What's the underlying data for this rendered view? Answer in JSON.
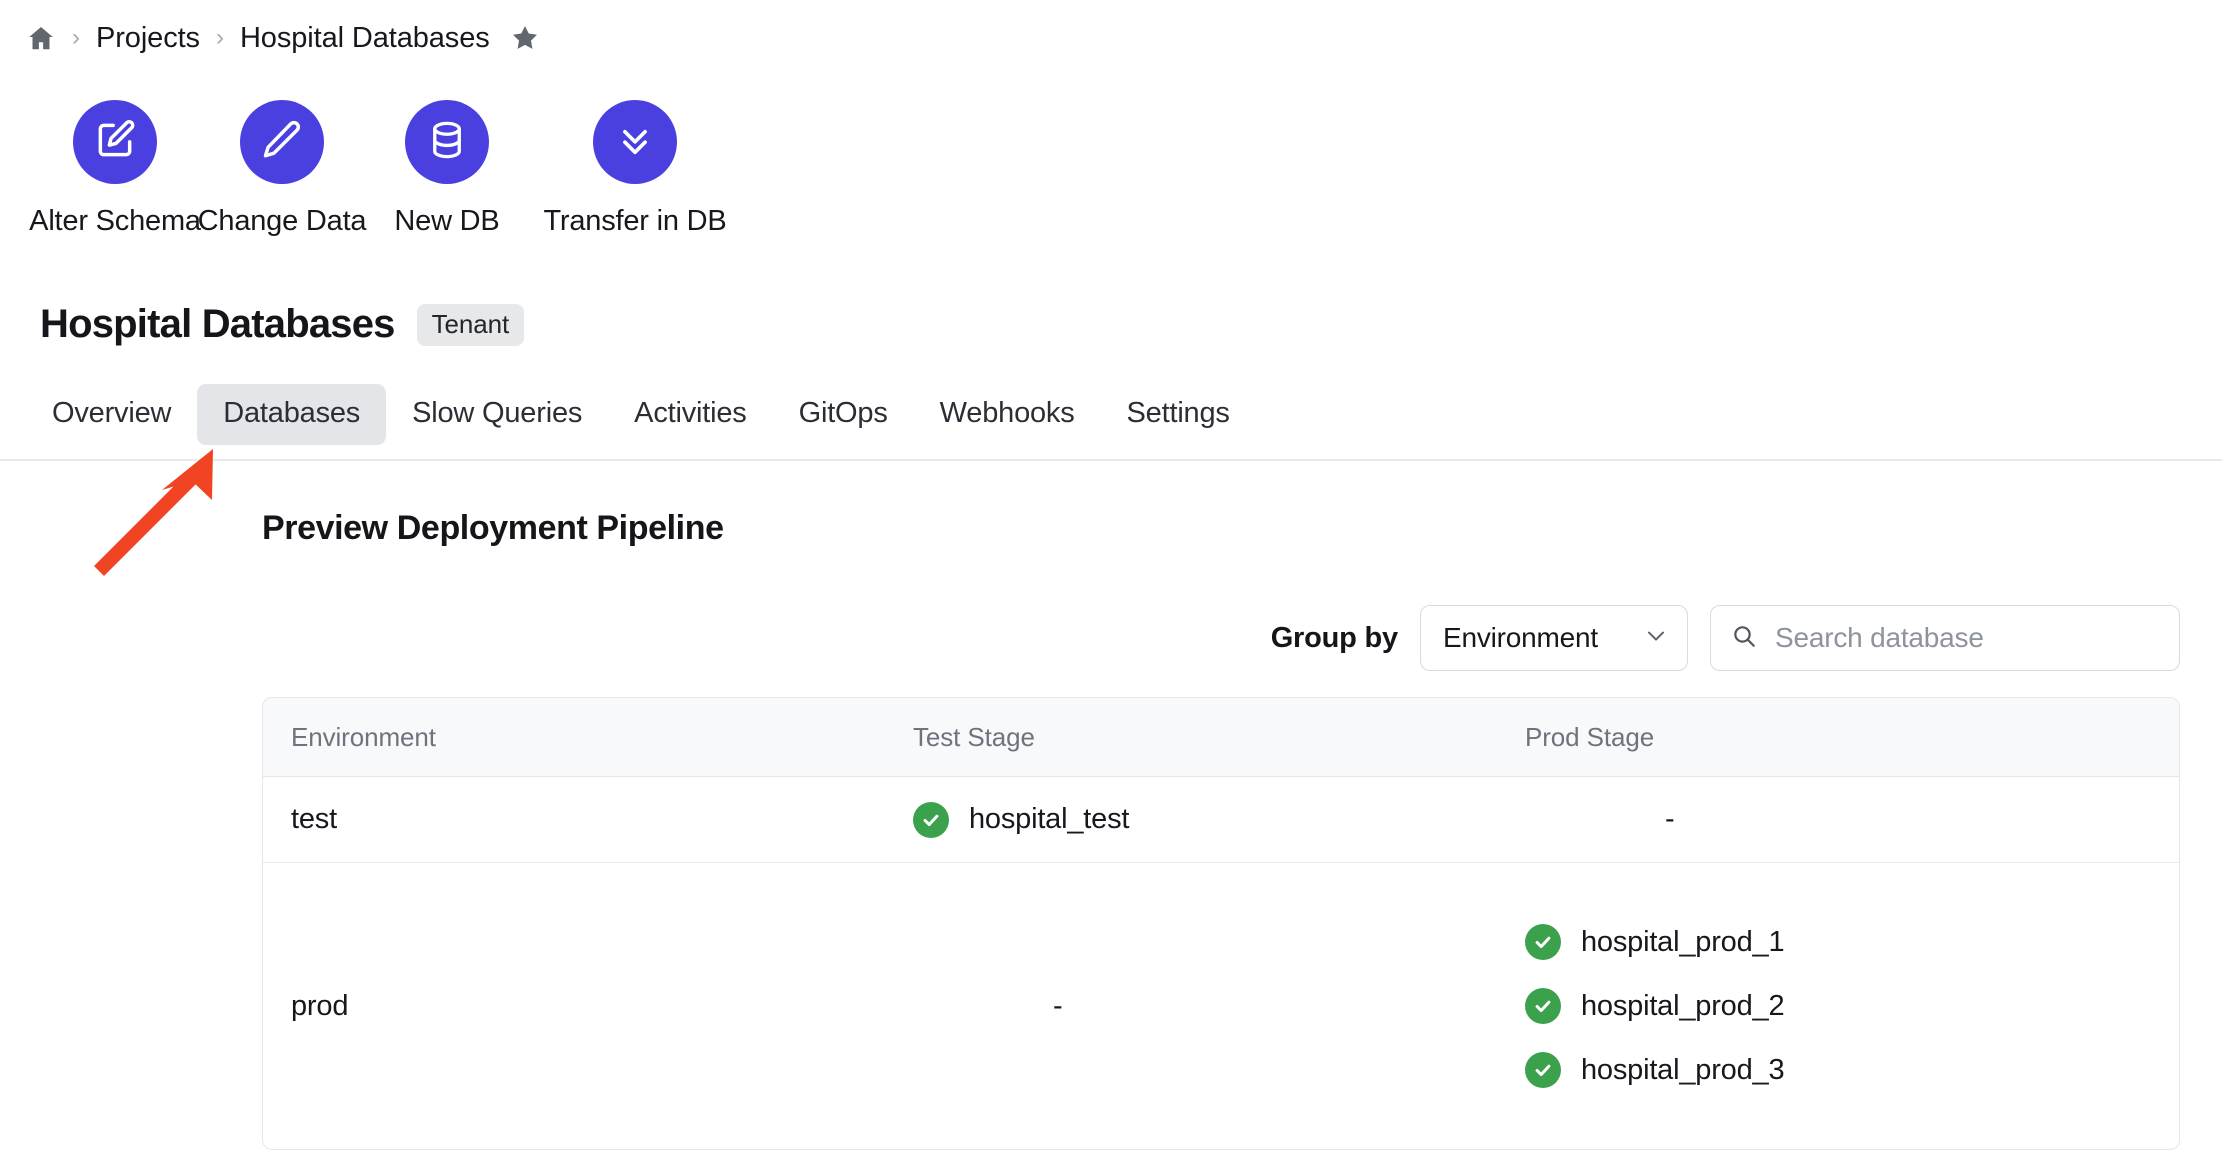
{
  "breadcrumb": {
    "home_icon": "home-icon",
    "separator": "›",
    "items": [
      {
        "label": "Projects"
      },
      {
        "label": "Hospital Databases"
      }
    ],
    "star_icon": "star-icon"
  },
  "actions": [
    {
      "label": "Alter Schema",
      "icon": "edit-square-icon"
    },
    {
      "label": "Change Data",
      "icon": "pencil-icon"
    },
    {
      "label": "New DB",
      "icon": "database-icon"
    },
    {
      "label": "Transfer in DB",
      "icon": "chevrons-down-icon"
    }
  ],
  "header": {
    "title": "Hospital Databases",
    "badge": "Tenant"
  },
  "tabs": [
    {
      "label": "Overview",
      "active": false
    },
    {
      "label": "Databases",
      "active": true
    },
    {
      "label": "Slow Queries",
      "active": false
    },
    {
      "label": "Activities",
      "active": false
    },
    {
      "label": "GitOps",
      "active": false
    },
    {
      "label": "Webhooks",
      "active": false
    },
    {
      "label": "Settings",
      "active": false
    }
  ],
  "main": {
    "section_heading": "Preview Deployment Pipeline",
    "toolbar": {
      "group_by_label": "Group by",
      "group_by_value": "Environment",
      "chevron_icon": "chevron-down-icon",
      "search_icon": "search-icon",
      "search_value": "",
      "search_placeholder": "Search database"
    },
    "table": {
      "columns": [
        "Environment",
        "Test Stage",
        "Prod Stage"
      ],
      "rows": [
        {
          "environment": "test",
          "test_stage": [
            {
              "name": "hospital_test",
              "status": "ok"
            }
          ],
          "prod_stage": [],
          "empty_marker": "-"
        },
        {
          "environment": "prod",
          "test_stage": [],
          "prod_stage": [
            {
              "name": "hospital_prod_1",
              "status": "ok"
            },
            {
              "name": "hospital_prod_2",
              "status": "ok"
            },
            {
              "name": "hospital_prod_3",
              "status": "ok"
            }
          ],
          "empty_marker": "-"
        }
      ],
      "empty_marker": "-"
    }
  },
  "annotation": {
    "type": "arrow",
    "color": "#f04423",
    "points_to": "tab-databases"
  },
  "colors": {
    "accent_purple": "#4a40e0",
    "status_green": "#3ba14d",
    "annotation_red": "#f04423",
    "badge_gray": "#e7e8ea",
    "active_tab_gray": "#e4e5e8"
  }
}
